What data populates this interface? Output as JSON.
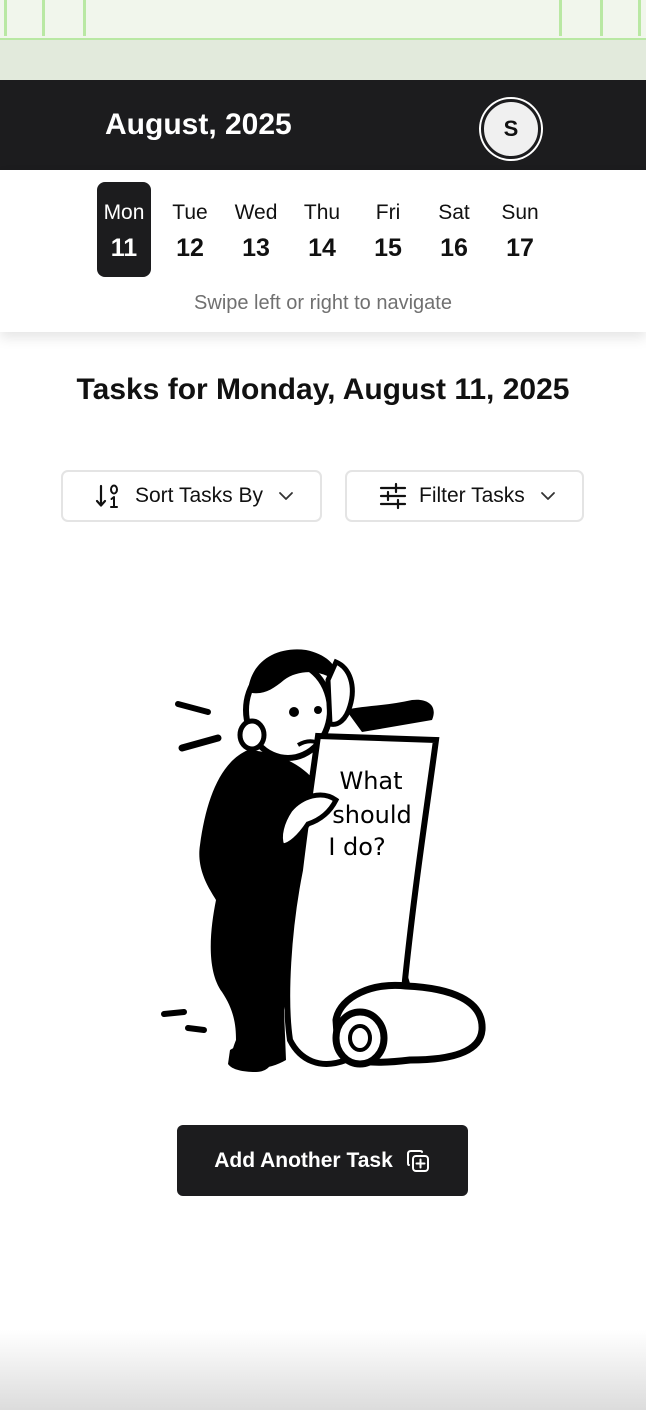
{
  "header": {
    "month_title": "August, 2025",
    "avatar_initial": "S"
  },
  "week": {
    "days": [
      {
        "name": "Mon",
        "num": "11",
        "selected": true
      },
      {
        "name": "Tue",
        "num": "12",
        "selected": false
      },
      {
        "name": "Wed",
        "num": "13",
        "selected": false
      },
      {
        "name": "Thu",
        "num": "14",
        "selected": false
      },
      {
        "name": "Fri",
        "num": "15",
        "selected": false
      },
      {
        "name": "Sat",
        "num": "16",
        "selected": false
      },
      {
        "name": "Sun",
        "num": "17",
        "selected": false
      }
    ],
    "swipe_hint": "Swipe left or right to navigate"
  },
  "tasks": {
    "title": "Tasks for Monday, August 11, 2025",
    "sort_label": "Sort Tasks By",
    "sort_icon": "sort-numeric-icon",
    "filter_label": "Filter Tasks",
    "filter_icon": "sliders-icon"
  },
  "empty_state": {
    "scroll_text_line1": "What",
    "scroll_text_line2": "should",
    "scroll_text_line3": "I do?"
  },
  "add_button": {
    "label": "Add Another Task",
    "icon": "copy-plus-icon"
  },
  "colors": {
    "header_bg": "#1c1c1e",
    "accent_green": "#b9e8a3",
    "text_muted": "#707070"
  }
}
